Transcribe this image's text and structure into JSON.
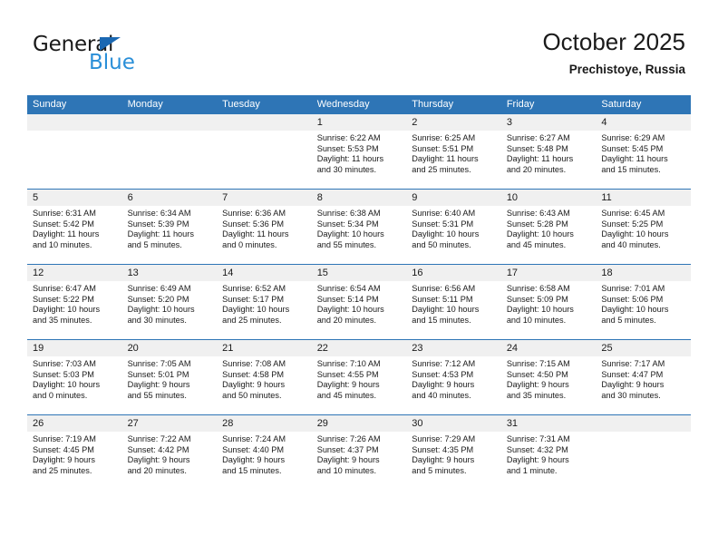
{
  "brand": {
    "name_top": "General",
    "name_bottom": "Blue",
    "triangle_color": "#1b68b2",
    "blue_color": "#2a8fd8"
  },
  "header": {
    "title": "October 2025",
    "location": "Prechistoye, Russia"
  },
  "theme": {
    "header_bg": "#2e75b6",
    "daynum_bg": "#f0f0f0",
    "text": "#1a1a1a"
  },
  "calendar": {
    "weekday_headers": [
      "Sunday",
      "Monday",
      "Tuesday",
      "Wednesday",
      "Thursday",
      "Friday",
      "Saturday"
    ],
    "weeks": [
      [
        {
          "day": "",
          "sunrise": "",
          "sunset": "",
          "daylight_1": "",
          "daylight_2": ""
        },
        {
          "day": "",
          "sunrise": "",
          "sunset": "",
          "daylight_1": "",
          "daylight_2": ""
        },
        {
          "day": "",
          "sunrise": "",
          "sunset": "",
          "daylight_1": "",
          "daylight_2": ""
        },
        {
          "day": "1",
          "sunrise": "Sunrise: 6:22 AM",
          "sunset": "Sunset: 5:53 PM",
          "daylight_1": "Daylight: 11 hours",
          "daylight_2": "and 30 minutes."
        },
        {
          "day": "2",
          "sunrise": "Sunrise: 6:25 AM",
          "sunset": "Sunset: 5:51 PM",
          "daylight_1": "Daylight: 11 hours",
          "daylight_2": "and 25 minutes."
        },
        {
          "day": "3",
          "sunrise": "Sunrise: 6:27 AM",
          "sunset": "Sunset: 5:48 PM",
          "daylight_1": "Daylight: 11 hours",
          "daylight_2": "and 20 minutes."
        },
        {
          "day": "4",
          "sunrise": "Sunrise: 6:29 AM",
          "sunset": "Sunset: 5:45 PM",
          "daylight_1": "Daylight: 11 hours",
          "daylight_2": "and 15 minutes."
        }
      ],
      [
        {
          "day": "5",
          "sunrise": "Sunrise: 6:31 AM",
          "sunset": "Sunset: 5:42 PM",
          "daylight_1": "Daylight: 11 hours",
          "daylight_2": "and 10 minutes."
        },
        {
          "day": "6",
          "sunrise": "Sunrise: 6:34 AM",
          "sunset": "Sunset: 5:39 PM",
          "daylight_1": "Daylight: 11 hours",
          "daylight_2": "and 5 minutes."
        },
        {
          "day": "7",
          "sunrise": "Sunrise: 6:36 AM",
          "sunset": "Sunset: 5:36 PM",
          "daylight_1": "Daylight: 11 hours",
          "daylight_2": "and 0 minutes."
        },
        {
          "day": "8",
          "sunrise": "Sunrise: 6:38 AM",
          "sunset": "Sunset: 5:34 PM",
          "daylight_1": "Daylight: 10 hours",
          "daylight_2": "and 55 minutes."
        },
        {
          "day": "9",
          "sunrise": "Sunrise: 6:40 AM",
          "sunset": "Sunset: 5:31 PM",
          "daylight_1": "Daylight: 10 hours",
          "daylight_2": "and 50 minutes."
        },
        {
          "day": "10",
          "sunrise": "Sunrise: 6:43 AM",
          "sunset": "Sunset: 5:28 PM",
          "daylight_1": "Daylight: 10 hours",
          "daylight_2": "and 45 minutes."
        },
        {
          "day": "11",
          "sunrise": "Sunrise: 6:45 AM",
          "sunset": "Sunset: 5:25 PM",
          "daylight_1": "Daylight: 10 hours",
          "daylight_2": "and 40 minutes."
        }
      ],
      [
        {
          "day": "12",
          "sunrise": "Sunrise: 6:47 AM",
          "sunset": "Sunset: 5:22 PM",
          "daylight_1": "Daylight: 10 hours",
          "daylight_2": "and 35 minutes."
        },
        {
          "day": "13",
          "sunrise": "Sunrise: 6:49 AM",
          "sunset": "Sunset: 5:20 PM",
          "daylight_1": "Daylight: 10 hours",
          "daylight_2": "and 30 minutes."
        },
        {
          "day": "14",
          "sunrise": "Sunrise: 6:52 AM",
          "sunset": "Sunset: 5:17 PM",
          "daylight_1": "Daylight: 10 hours",
          "daylight_2": "and 25 minutes."
        },
        {
          "day": "15",
          "sunrise": "Sunrise: 6:54 AM",
          "sunset": "Sunset: 5:14 PM",
          "daylight_1": "Daylight: 10 hours",
          "daylight_2": "and 20 minutes."
        },
        {
          "day": "16",
          "sunrise": "Sunrise: 6:56 AM",
          "sunset": "Sunset: 5:11 PM",
          "daylight_1": "Daylight: 10 hours",
          "daylight_2": "and 15 minutes."
        },
        {
          "day": "17",
          "sunrise": "Sunrise: 6:58 AM",
          "sunset": "Sunset: 5:09 PM",
          "daylight_1": "Daylight: 10 hours",
          "daylight_2": "and 10 minutes."
        },
        {
          "day": "18",
          "sunrise": "Sunrise: 7:01 AM",
          "sunset": "Sunset: 5:06 PM",
          "daylight_1": "Daylight: 10 hours",
          "daylight_2": "and 5 minutes."
        }
      ],
      [
        {
          "day": "19",
          "sunrise": "Sunrise: 7:03 AM",
          "sunset": "Sunset: 5:03 PM",
          "daylight_1": "Daylight: 10 hours",
          "daylight_2": "and 0 minutes."
        },
        {
          "day": "20",
          "sunrise": "Sunrise: 7:05 AM",
          "sunset": "Sunset: 5:01 PM",
          "daylight_1": "Daylight: 9 hours",
          "daylight_2": "and 55 minutes."
        },
        {
          "day": "21",
          "sunrise": "Sunrise: 7:08 AM",
          "sunset": "Sunset: 4:58 PM",
          "daylight_1": "Daylight: 9 hours",
          "daylight_2": "and 50 minutes."
        },
        {
          "day": "22",
          "sunrise": "Sunrise: 7:10 AM",
          "sunset": "Sunset: 4:55 PM",
          "daylight_1": "Daylight: 9 hours",
          "daylight_2": "and 45 minutes."
        },
        {
          "day": "23",
          "sunrise": "Sunrise: 7:12 AM",
          "sunset": "Sunset: 4:53 PM",
          "daylight_1": "Daylight: 9 hours",
          "daylight_2": "and 40 minutes."
        },
        {
          "day": "24",
          "sunrise": "Sunrise: 7:15 AM",
          "sunset": "Sunset: 4:50 PM",
          "daylight_1": "Daylight: 9 hours",
          "daylight_2": "and 35 minutes."
        },
        {
          "day": "25",
          "sunrise": "Sunrise: 7:17 AM",
          "sunset": "Sunset: 4:47 PM",
          "daylight_1": "Daylight: 9 hours",
          "daylight_2": "and 30 minutes."
        }
      ],
      [
        {
          "day": "26",
          "sunrise": "Sunrise: 7:19 AM",
          "sunset": "Sunset: 4:45 PM",
          "daylight_1": "Daylight: 9 hours",
          "daylight_2": "and 25 minutes."
        },
        {
          "day": "27",
          "sunrise": "Sunrise: 7:22 AM",
          "sunset": "Sunset: 4:42 PM",
          "daylight_1": "Daylight: 9 hours",
          "daylight_2": "and 20 minutes."
        },
        {
          "day": "28",
          "sunrise": "Sunrise: 7:24 AM",
          "sunset": "Sunset: 4:40 PM",
          "daylight_1": "Daylight: 9 hours",
          "daylight_2": "and 15 minutes."
        },
        {
          "day": "29",
          "sunrise": "Sunrise: 7:26 AM",
          "sunset": "Sunset: 4:37 PM",
          "daylight_1": "Daylight: 9 hours",
          "daylight_2": "and 10 minutes."
        },
        {
          "day": "30",
          "sunrise": "Sunrise: 7:29 AM",
          "sunset": "Sunset: 4:35 PM",
          "daylight_1": "Daylight: 9 hours",
          "daylight_2": "and 5 minutes."
        },
        {
          "day": "31",
          "sunrise": "Sunrise: 7:31 AM",
          "sunset": "Sunset: 4:32 PM",
          "daylight_1": "Daylight: 9 hours",
          "daylight_2": "and 1 minute."
        },
        {
          "day": "",
          "sunrise": "",
          "sunset": "",
          "daylight_1": "",
          "daylight_2": ""
        }
      ]
    ]
  }
}
